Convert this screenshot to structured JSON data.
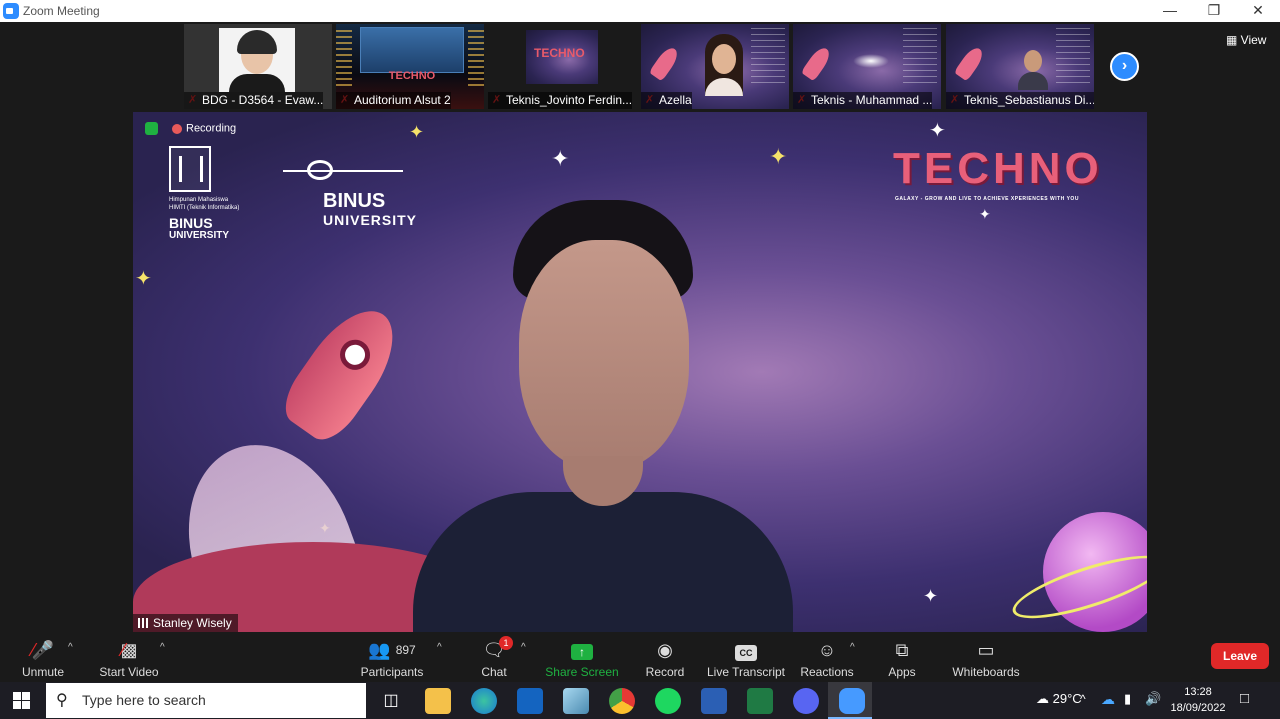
{
  "window": {
    "title": "Zoom Meeting"
  },
  "top": {
    "view_label": "View",
    "thumbnails": [
      {
        "name": "BDG -  D3564 - Evaw..."
      },
      {
        "name": "Auditorium Alsut 2"
      },
      {
        "name": "Teknis_Jovinto Ferdin..."
      },
      {
        "name": "Azella"
      },
      {
        "name": "Teknis - Muhammad ..."
      },
      {
        "name": "Teknis_Sebastianus Di..."
      }
    ]
  },
  "main": {
    "recording_label": "Recording",
    "speaker_name": "Stanley Wisely",
    "hmif_lines": [
      "Himpunan Mahasiswa",
      "HIMTI (Teknik Informatika)",
      "BINUS",
      "UNIVERSITY"
    ],
    "binus_lines": [
      "BINUS",
      "UNIVERSITY"
    ],
    "techno_title": "TECHNO",
    "techno_tagline": "GALAXY - GROW AND LIVE TO ACHIEVE XPERIENCES WITH YOU"
  },
  "toolbar": {
    "unmute": "Unmute",
    "start_video": "Start Video",
    "participants": "Participants",
    "participants_count": "897",
    "chat": "Chat",
    "chat_badge": "1",
    "share_screen": "Share Screen",
    "record": "Record",
    "live_transcript": "Live Transcript",
    "reactions": "Reactions",
    "apps": "Apps",
    "whiteboards": "Whiteboards",
    "leave": "Leave"
  },
  "taskbar": {
    "search_placeholder": "Type here to search",
    "temperature": "29°C",
    "time": "13:28",
    "date": "18/09/2022"
  },
  "colors": {
    "accent": "#2d8cff",
    "leave": "#e02828",
    "share": "#1fb141"
  }
}
